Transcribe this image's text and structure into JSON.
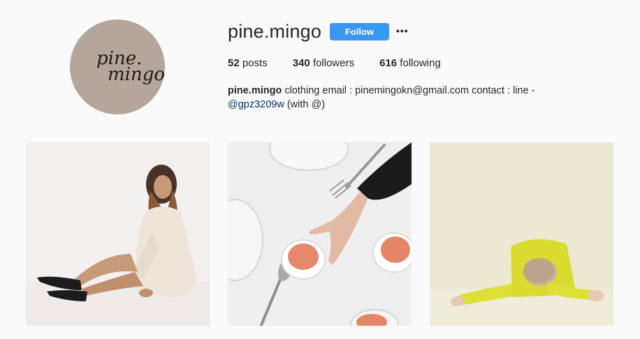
{
  "profile": {
    "username": "pine.mingo",
    "avatar_logo_line1": "pine.",
    "avatar_logo_line2": "mingo",
    "follow_label": "Follow",
    "more_icon": "more-options-icon",
    "stats": {
      "posts_count": "52",
      "posts_label": " posts",
      "followers_count": "340",
      "followers_label": " followers",
      "following_count": "616",
      "following_label": " following"
    },
    "bio": {
      "name": "pine.mingo",
      "text": " clothing email : pinemingokn@gmail.com contact : line -",
      "handle": "@gpz3209w",
      "suffix": " (with @)"
    }
  },
  "colors": {
    "follow_button": "#3897f0",
    "avatar_bg": "#b5a59a",
    "page_bg": "#fafafa",
    "link": "#003569"
  },
  "posts": [
    {
      "description_icon": "woman-sitting-photo"
    },
    {
      "description_icon": "tea-cups-table-photo"
    },
    {
      "description_icon": "yellow-sweater-photo"
    }
  ]
}
